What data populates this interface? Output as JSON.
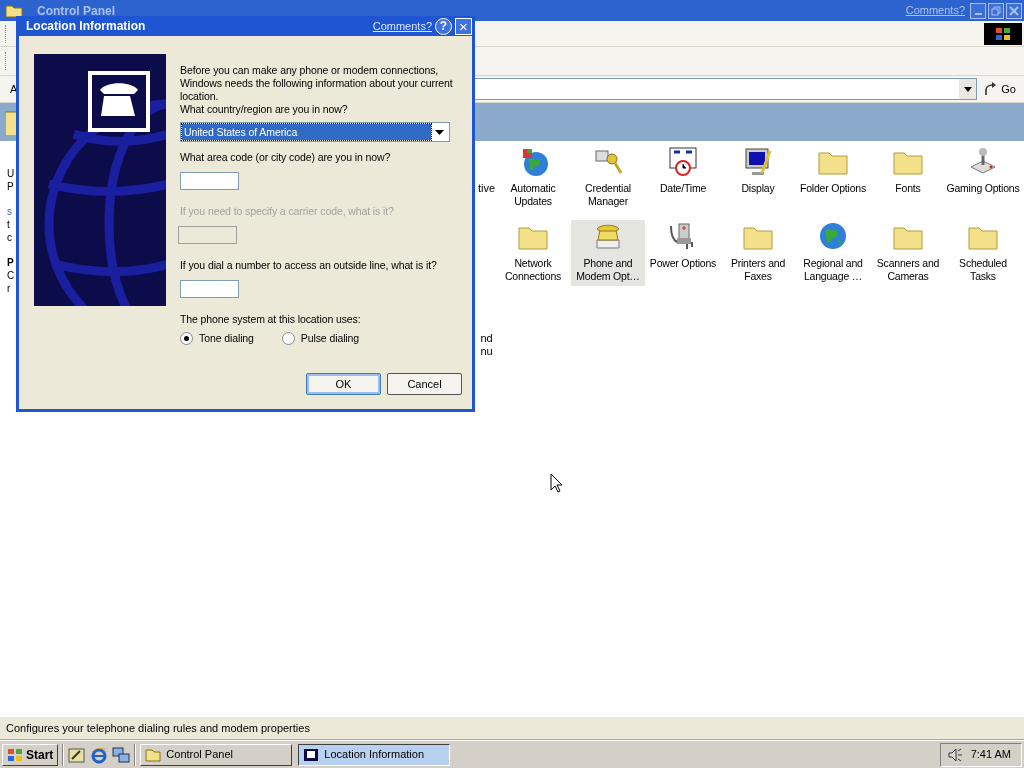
{
  "main_window": {
    "title": "Control Panel",
    "comments_link": "Comments?",
    "address_label": "A",
    "go_button": "Go",
    "left_pane": [
      [
        {
          "text": "U",
          "kind": "plain"
        },
        {
          "text": "P",
          "kind": "plain"
        }
      ],
      [
        {
          "text": "s",
          "kind": "link"
        },
        {
          "text": "t",
          "kind": "plain"
        },
        {
          "text": "c",
          "kind": "plain"
        }
      ],
      [
        {
          "text": "P",
          "kind": "heading"
        },
        {
          "text": "C",
          "kind": "plain"
        },
        {
          "text": "r",
          "kind": "plain"
        }
      ]
    ],
    "cut_labels": [
      [
        "tive"
      ],
      [
        "nd",
        "nu"
      ]
    ],
    "items": [
      {
        "label": "Automatic Updates",
        "selected": false
      },
      {
        "label": "Credential Manager",
        "selected": false
      },
      {
        "label": "Date/Time",
        "selected": false
      },
      {
        "label": "Display",
        "selected": false
      },
      {
        "label": "Folder Options",
        "selected": false
      },
      {
        "label": "Fonts",
        "selected": false
      },
      {
        "label": "Gaming Options",
        "selected": false
      },
      {
        "label": "Network Connections",
        "selected": false
      },
      {
        "label": "Phone and Modem Opt…",
        "selected": true
      },
      {
        "label": "Power Options",
        "selected": false
      },
      {
        "label": "Printers and Faxes",
        "selected": false
      },
      {
        "label": "Regional and Language …",
        "selected": false
      },
      {
        "label": "Scanners and Cameras",
        "selected": false
      },
      {
        "label": "Scheduled Tasks",
        "selected": false
      }
    ]
  },
  "dialog": {
    "title": "Location Information",
    "comments_link": "Comments?",
    "help_button": "?",
    "close_button": "×",
    "intro": "Before you can make any phone or modem connections, Windows needs the following information about your current location.",
    "country_label": "What country/region are you in now?",
    "country_value": "United States of America",
    "country_focused": true,
    "fields": [
      {
        "label": "What area code (or city code) are you in now?",
        "disabled": false
      },
      {
        "label": "If you need to specify a carrier code, what is it?",
        "disabled": true
      },
      {
        "label": "If you dial a number to access an outside line, what is it?",
        "disabled": false
      }
    ],
    "dialing_label": "The phone system at this location uses:",
    "dialing_options": [
      {
        "label": "Tone dialing",
        "selected": true
      },
      {
        "label": "Pulse dialing",
        "selected": false
      }
    ],
    "buttons": [
      {
        "label": "OK",
        "default": true
      },
      {
        "label": "Cancel",
        "default": false
      }
    ]
  },
  "status_bar": "Configures your telephone dialing rules and modem properties",
  "taskbar": {
    "start": "Start",
    "tasks": [
      {
        "label": "Control Panel",
        "selected": false
      },
      {
        "label": "Location Information",
        "selected": true
      }
    ],
    "clock": "7:41 AM"
  }
}
